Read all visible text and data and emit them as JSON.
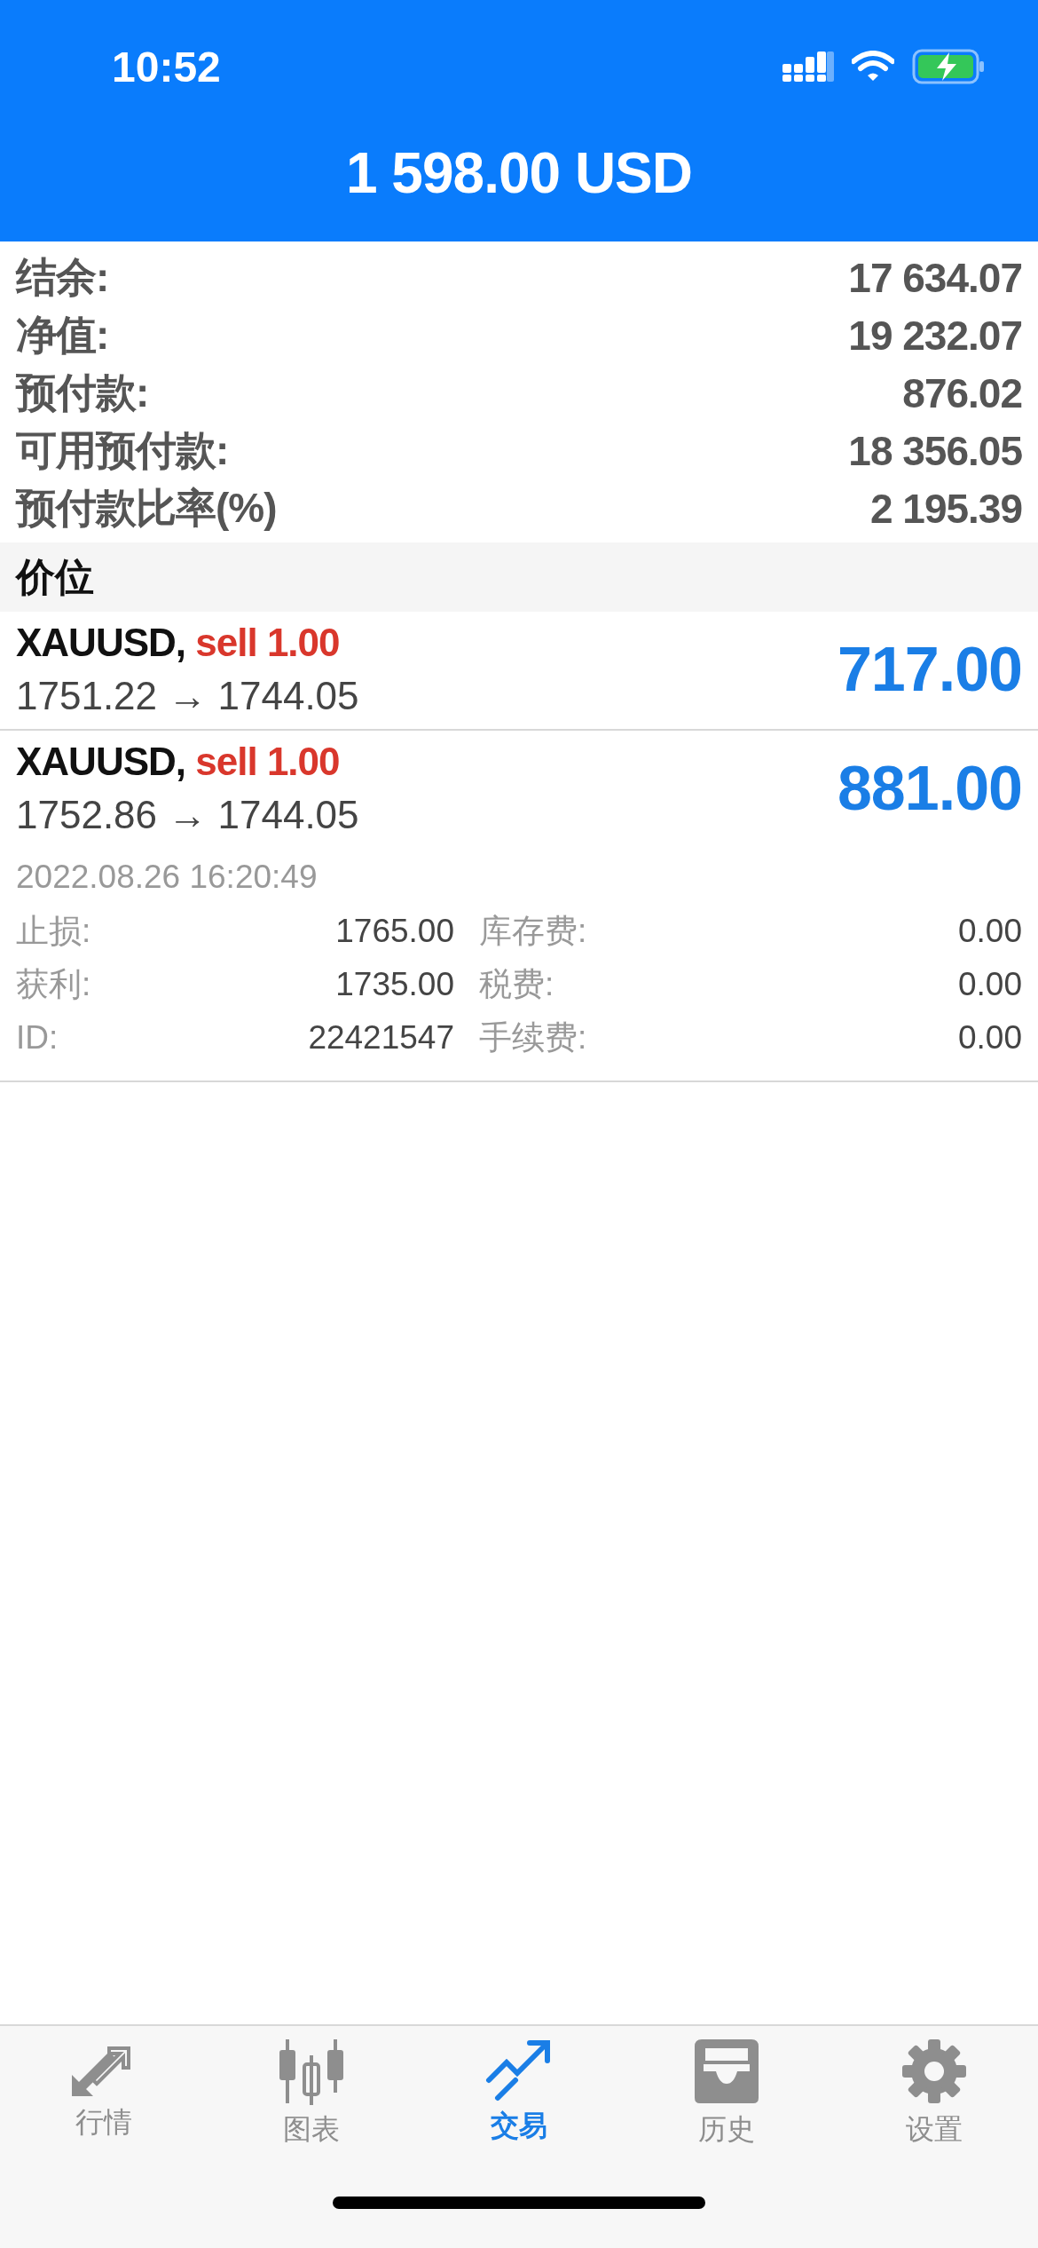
{
  "status_bar": {
    "time": "10:52"
  },
  "header": {
    "title": "1 598.00 USD"
  },
  "summary": [
    {
      "label": "结余:",
      "value": "17 634.07"
    },
    {
      "label": "净值:",
      "value": "19 232.07"
    },
    {
      "label": "预付款:",
      "value": "876.02"
    },
    {
      "label": "可用预付款:",
      "value": "18 356.05"
    },
    {
      "label": "预付款比率(%)",
      "value": "2 195.39"
    }
  ],
  "section": {
    "title": "价位"
  },
  "positions": [
    {
      "symbol": "XAUUSD,",
      "order": "sell 1.00",
      "prices": "1751.22 → 1744.05",
      "profit": "717.00",
      "expanded": false
    },
    {
      "symbol": "XAUUSD,",
      "order": "sell 1.00",
      "prices": "1752.86 → 1744.05",
      "profit": "881.00",
      "expanded": true,
      "time": "2022.08.26 16:20:49",
      "details": [
        {
          "label": "止损:",
          "value": "1765.00"
        },
        {
          "label": "库存费:",
          "value": "0.00"
        },
        {
          "label": "获利:",
          "value": "1735.00"
        },
        {
          "label": "税费:",
          "value": "0.00"
        },
        {
          "label": "ID:",
          "value": "22421547"
        },
        {
          "label": "手续费:",
          "value": "0.00"
        }
      ]
    }
  ],
  "tabs": [
    {
      "kind": "quotes",
      "label": "行情",
      "selected": false
    },
    {
      "kind": "chart",
      "label": "图表",
      "selected": false
    },
    {
      "kind": "trade",
      "label": "交易",
      "selected": true
    },
    {
      "kind": "history",
      "label": "历史",
      "selected": false
    },
    {
      "kind": "settings",
      "label": "设置",
      "selected": false
    }
  ]
}
